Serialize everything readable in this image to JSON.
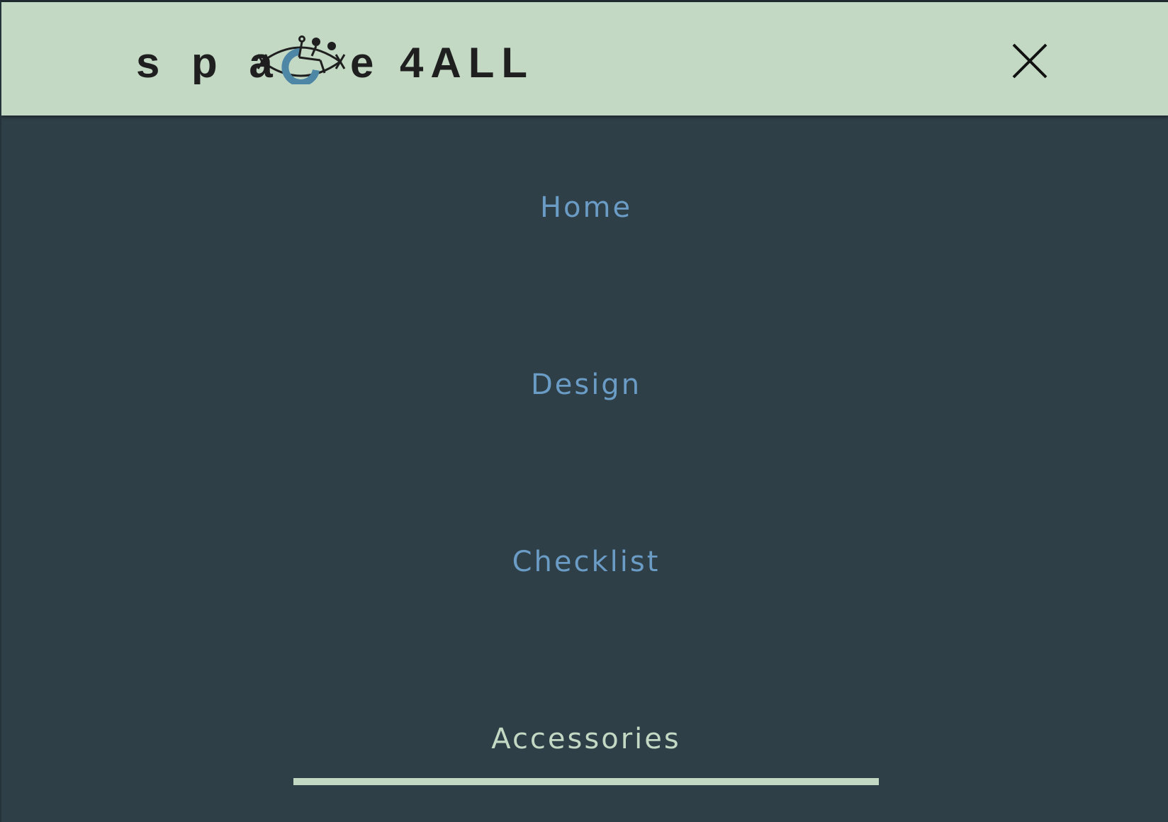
{
  "header": {
    "logo_text": "space 4ALL",
    "logo_parts": {
      "prefix": "s p a",
      "suffix": "e 4ALL"
    },
    "close_icon": "close-icon"
  },
  "menu": {
    "items": [
      {
        "label": "Home",
        "active": false
      },
      {
        "label": "Design",
        "active": false
      },
      {
        "label": "Checklist",
        "active": false
      },
      {
        "label": "Accessories",
        "active": true
      }
    ]
  },
  "colors": {
    "header_bg": "#c3d9c4",
    "menu_bg": "#2f3f48",
    "link": "#6a9cc6",
    "active_link": "#c3d9c4",
    "logo_accent": "#4e86a6"
  }
}
